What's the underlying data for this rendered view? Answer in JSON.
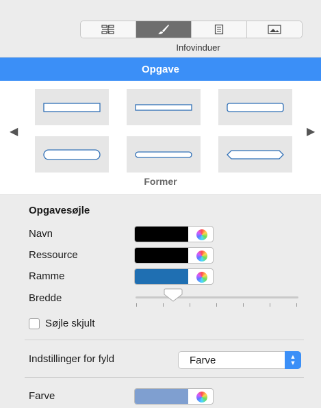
{
  "toolbar": {
    "tabs": [
      {
        "icon": "gantt-icon",
        "active": false
      },
      {
        "icon": "brush-icon",
        "active": true
      },
      {
        "icon": "document-icon",
        "active": false
      },
      {
        "icon": "picture-icon",
        "active": false
      }
    ],
    "label": "Infovinduer"
  },
  "section_title": "Opgave",
  "shapes": {
    "caption": "Former",
    "tiles": [
      "rectangle",
      "thin-rectangle",
      "rounded-rectangle",
      "pill",
      "thin-pill",
      "hexagon"
    ]
  },
  "task_bar": {
    "heading": "Opgavesøjle",
    "name_label": "Navn",
    "name_color": "#000000",
    "resource_label": "Ressource",
    "resource_color": "#000000",
    "border_label": "Ramme",
    "border_color": "#1f6fb2",
    "width_label": "Bredde",
    "width_value": 0.25,
    "hidden_label": "Søjle skjult",
    "hidden_checked": false
  },
  "fill": {
    "settings_label": "Indstillinger for fyld",
    "settings_value": "Farve",
    "color_label": "Farve",
    "color": "#7f9fd0"
  },
  "colors": {
    "accent": "#3b8ff7",
    "panel_bg": "#ececec",
    "tile_bg": "#e6e6e6",
    "shape_stroke": "#2f6fb6"
  }
}
